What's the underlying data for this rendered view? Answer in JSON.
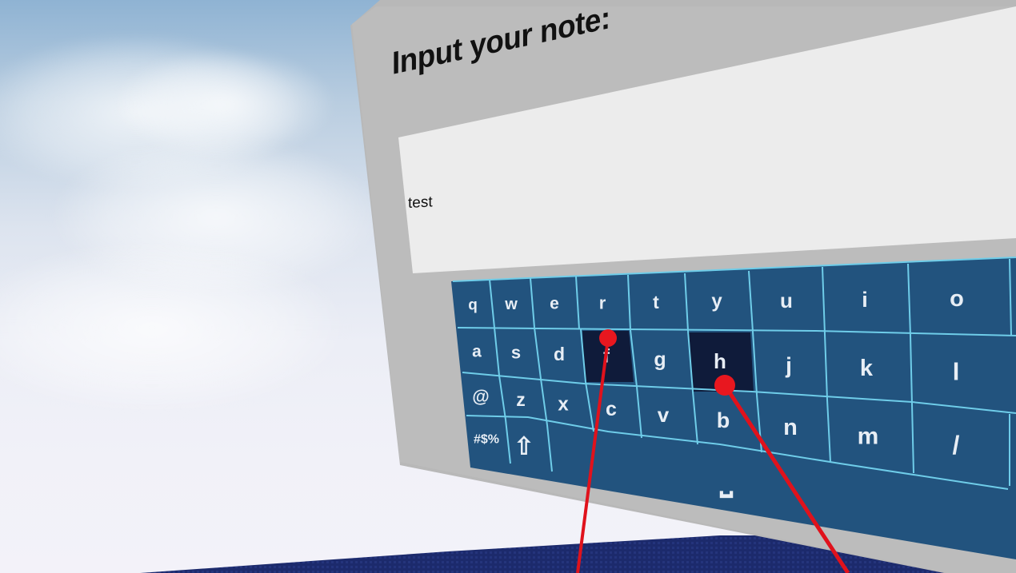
{
  "note_panel": {
    "title": "Input your note:",
    "note_value": "test"
  },
  "keyboard": {
    "rows": [
      [
        "q",
        "w",
        "e",
        "r",
        "t",
        "y",
        "u",
        "i",
        "o"
      ],
      [
        "a",
        "s",
        "d",
        "f",
        "g",
        "h",
        "j",
        "k",
        "l"
      ],
      [
        "@",
        "z",
        "x",
        "c",
        "v",
        "b",
        "n",
        "m",
        "/"
      ],
      [
        "#$%",
        "shift-arrow-icon",
        "space-bar-icon"
      ]
    ],
    "highlighted_keys": [
      "f",
      "h"
    ],
    "labels": {
      "shift": "⇧",
      "symbols": "#$%",
      "space": "⎵"
    }
  },
  "colors": {
    "panel_gray": "#bdbdbd",
    "note_field": "#ebebeb",
    "keyboard_bg": "#22537e",
    "key_grid_lines": "#7fd3ee",
    "key_pressed": "#0f1b3a",
    "laser_pointer": "#e8171f",
    "floor": "#1d2a6e"
  }
}
